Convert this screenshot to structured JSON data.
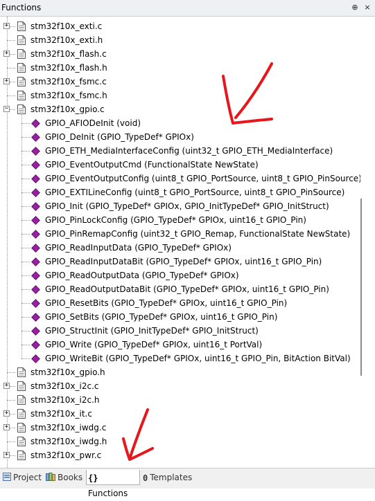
{
  "panel": {
    "title": "Functions",
    "pin_glyph": "⊕",
    "close_glyph": "×"
  },
  "tree": {
    "files": [
      {
        "name": "stm32f10x_exti.c",
        "expandable": true
      },
      {
        "name": "stm32f10x_exti.h",
        "expandable": false
      },
      {
        "name": "stm32f10x_flash.c",
        "expandable": true
      },
      {
        "name": "stm32f10x_flash.h",
        "expandable": false
      },
      {
        "name": "stm32f10x_fsmc.c",
        "expandable": true
      },
      {
        "name": "stm32f10x_fsmc.h",
        "expandable": false
      },
      {
        "name": "stm32f10x_gpio.c",
        "expandable": true,
        "expanded": true
      }
    ],
    "gpio_functions": [
      "GPIO_AFIODeInit (void)",
      "GPIO_DeInit (GPIO_TypeDef* GPIOx)",
      "GPIO_ETH_MediaInterfaceConfig (uint32_t GPIO_ETH_MediaInterface)",
      "GPIO_EventOutputCmd (FunctionalState NewState)",
      "GPIO_EventOutputConfig (uint8_t GPIO_PortSource, uint8_t GPIO_PinSource)",
      "GPIO_EXTILineConfig (uint8_t GPIO_PortSource, uint8_t GPIO_PinSource)",
      "GPIO_Init (GPIO_TypeDef* GPIOx, GPIO_InitTypeDef* GPIO_InitStruct)",
      "GPIO_PinLockConfig (GPIO_TypeDef* GPIOx, uint16_t GPIO_Pin)",
      "GPIO_PinRemapConfig (uint32_t GPIO_Remap, FunctionalState NewState)",
      "GPIO_ReadInputData (GPIO_TypeDef* GPIOx)",
      "GPIO_ReadInputDataBit (GPIO_TypeDef* GPIOx, uint16_t GPIO_Pin)",
      "GPIO_ReadOutputData (GPIO_TypeDef* GPIOx)",
      "GPIO_ReadOutputDataBit (GPIO_TypeDef* GPIOx, uint16_t GPIO_Pin)",
      "GPIO_ResetBits (GPIO_TypeDef* GPIOx, uint16_t GPIO_Pin)",
      "GPIO_SetBits (GPIO_TypeDef* GPIOx, uint16_t GPIO_Pin)",
      "GPIO_StructInit (GPIO_InitTypeDef* GPIO_InitStruct)",
      "GPIO_Write (GPIO_TypeDef* GPIOx, uint16_t PortVal)",
      "GPIO_WriteBit (GPIO_TypeDef* GPIOx, uint16_t GPIO_Pin, BitAction BitVal)"
    ],
    "files_after": [
      {
        "name": "stm32f10x_gpio.h",
        "expandable": false
      },
      {
        "name": "stm32f10x_i2c.c",
        "expandable": true
      },
      {
        "name": "stm32f10x_i2c.h",
        "expandable": false
      },
      {
        "name": "stm32f10x_it.c",
        "expandable": true
      },
      {
        "name": "stm32f10x_iwdg.c",
        "expandable": true
      },
      {
        "name": "stm32f10x_iwdg.h",
        "expandable": false
      },
      {
        "name": "stm32f10x_pwr.c",
        "expandable": true
      }
    ]
  },
  "tabs": [
    {
      "label": "Project",
      "icon": "project-icon",
      "active": false
    },
    {
      "label": "Books",
      "icon": "books-icon",
      "active": false
    },
    {
      "label": "Functions",
      "icon": "functions-icon",
      "active": true,
      "glyph": "{}"
    },
    {
      "label": "Templates",
      "icon": "templates-icon",
      "active": false,
      "glyph": "0"
    }
  ],
  "colors": {
    "function_marker": "#9b1fa6",
    "annotation_arrow": "#e8151b",
    "titlebar": "#eef0f3"
  }
}
